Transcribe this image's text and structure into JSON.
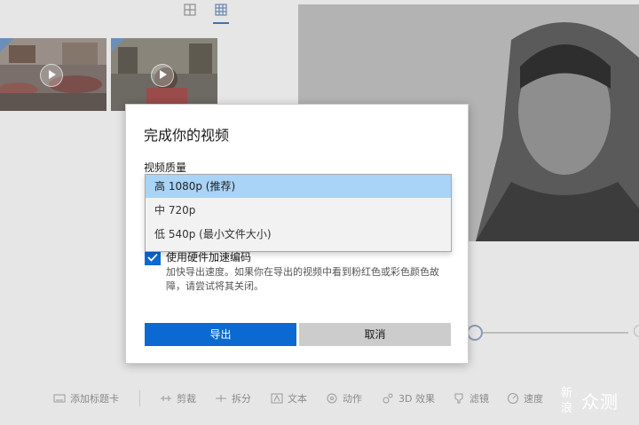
{
  "dialog": {
    "title": "完成你的视频",
    "quality_label": "视频质量",
    "quality_options": [
      {
        "label": "高 1080p (推荐)",
        "selected": true
      },
      {
        "label": "中 720p",
        "selected": false
      },
      {
        "label": "低 540p (最小文件大小)",
        "selected": false
      }
    ],
    "hardware_accel": {
      "checked": true,
      "label": "使用硬件加速编码",
      "description": "加快导出速度。如果你在导出的视频中看到粉红色或彩色颜色故障，请尝试将其关闭。"
    },
    "export_button": "导出",
    "cancel_button": "取消"
  },
  "toolbar": {
    "add_title_card": "添加标题卡",
    "trim": "剪裁",
    "split": "拆分",
    "text": "文本",
    "motion": "动作",
    "effects_3d": "3D 效果",
    "filters": "滤镜",
    "speed": "速度"
  },
  "watermark": {
    "glyph_top": "新",
    "glyph_bottom": "浪",
    "text": "众测"
  },
  "colors": {
    "accent": "#0a6ad2",
    "selected_option": "#a9d3f7",
    "dim_background": "#e6e6e6"
  }
}
